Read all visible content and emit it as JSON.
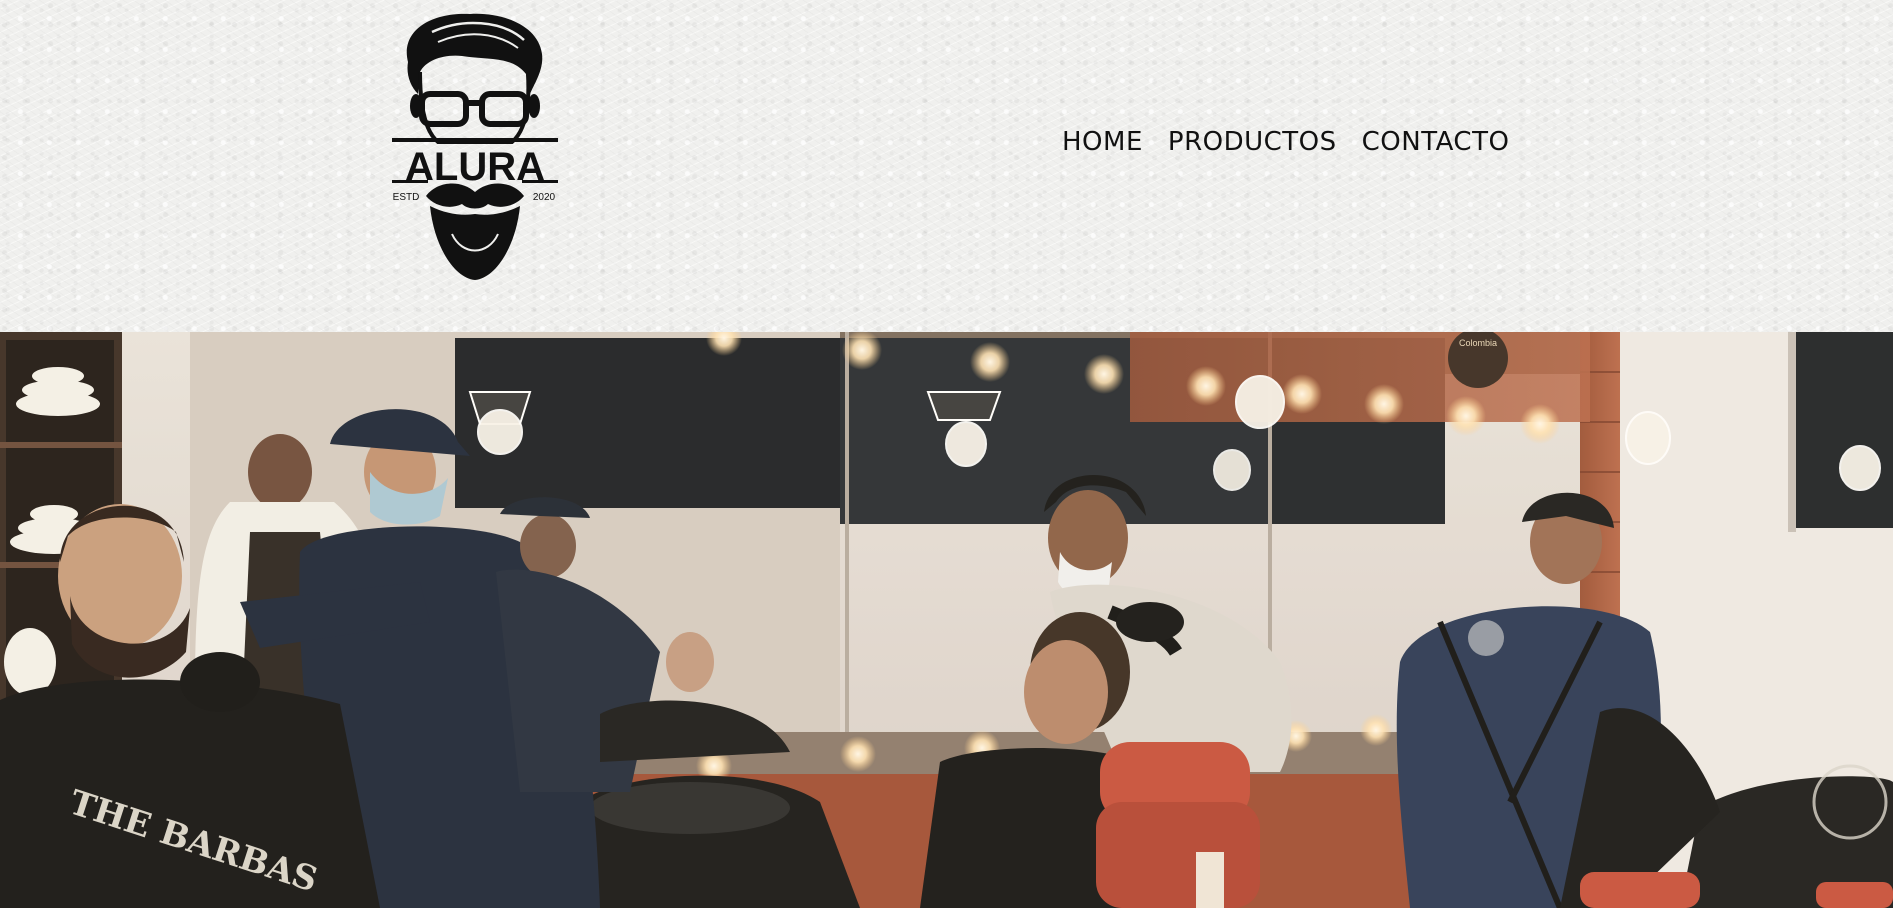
{
  "brand": {
    "name": "ALURA",
    "est_left": "ESTD",
    "est_right": "2020"
  },
  "nav": {
    "items": [
      {
        "label": "HOME"
      },
      {
        "label": "PRODUCTOS"
      },
      {
        "label": "CONTACTO"
      }
    ]
  },
  "hero": {
    "cape_text": "THE BARBAS",
    "mirror_sign": "Colombia",
    "colors": {
      "wall": "#e3ddd7",
      "brick": "#a85a3e",
      "mirror_dark": "#1d2126",
      "uniform": "#1f2a3d",
      "cape": "#151515",
      "chair": "#c8503c",
      "bulb": "#fff1d6"
    }
  }
}
